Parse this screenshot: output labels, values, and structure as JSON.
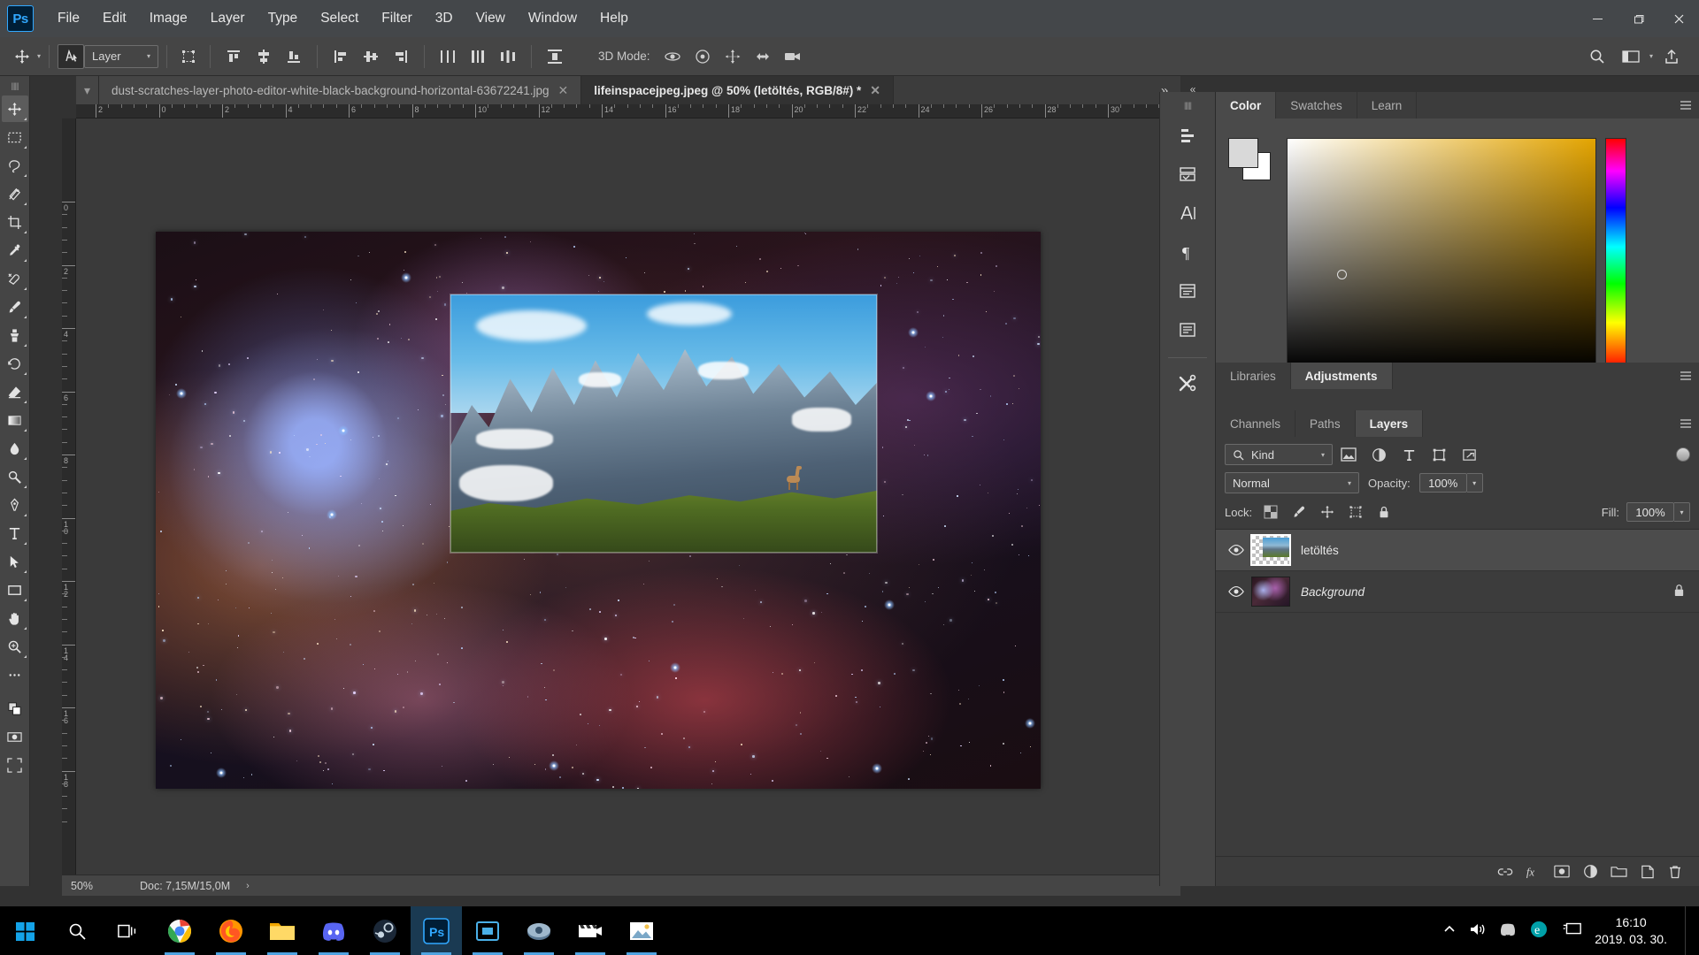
{
  "app": {
    "logo": "Ps",
    "menu": [
      "File",
      "Edit",
      "Image",
      "Layer",
      "Type",
      "Select",
      "Filter",
      "3D",
      "View",
      "Window",
      "Help"
    ],
    "window_controls": {
      "minimize": "—",
      "maximize": "❐",
      "close": "✕"
    }
  },
  "options_bar": {
    "tool_preset_label": "move-tool",
    "layer_select_value": "Layer",
    "mode_3d_label": "3D Mode:",
    "search_icon": "search-icon",
    "arrange_icon": "arrange-documents-icon",
    "share_icon": "share-icon"
  },
  "tabs": [
    {
      "title": "dust-scratches-layer-photo-editor-white-black-background-horizontal-63672241.jpg",
      "active": false,
      "close": "✕"
    },
    {
      "title": "lifeinspacejpeg.jpeg @ 50% (letöltés, RGB/8#) *",
      "active": true,
      "close": "✕"
    }
  ],
  "tab_overflow": "»",
  "toolbar": {
    "tools": [
      {
        "name": "move-tool",
        "glyph": "move"
      },
      {
        "name": "rectangular-marquee-tool",
        "glyph": "marquee"
      },
      {
        "name": "lasso-tool",
        "glyph": "lasso"
      },
      {
        "name": "object-selection-tool",
        "glyph": "wand"
      },
      {
        "name": "crop-tool",
        "glyph": "crop"
      },
      {
        "name": "eyedropper-tool",
        "glyph": "eyedropper"
      },
      {
        "name": "spot-healing-brush-tool",
        "glyph": "healing"
      },
      {
        "name": "brush-tool",
        "glyph": "brush"
      },
      {
        "name": "clone-stamp-tool",
        "glyph": "stamp"
      },
      {
        "name": "history-brush-tool",
        "glyph": "history"
      },
      {
        "name": "eraser-tool",
        "glyph": "eraser"
      },
      {
        "name": "gradient-tool",
        "glyph": "gradient"
      },
      {
        "name": "blur-tool",
        "glyph": "blur"
      },
      {
        "name": "dodge-tool",
        "glyph": "dodge"
      },
      {
        "name": "pen-tool",
        "glyph": "pen"
      },
      {
        "name": "horizontal-type-tool",
        "glyph": "type"
      },
      {
        "name": "path-selection-tool",
        "glyph": "path"
      },
      {
        "name": "rectangle-tool",
        "glyph": "rectangle"
      },
      {
        "name": "hand-tool",
        "glyph": "hand"
      },
      {
        "name": "zoom-tool",
        "glyph": "zoom"
      },
      {
        "name": "edit-toolbar-tool",
        "glyph": "dots"
      }
    ]
  },
  "rulers": {
    "top_labels": [
      "2",
      "0",
      "2",
      "4",
      "6",
      "8",
      "10",
      "12",
      "14",
      "16",
      "18",
      "20",
      "22",
      "24",
      "26",
      "28",
      "30"
    ],
    "left_labels": [
      "0",
      "2",
      "4",
      "6",
      "8",
      "10",
      "12",
      "14",
      "16",
      "18"
    ],
    "unit": "cm"
  },
  "canvas": {
    "document_title": "lifeinspacejpeg.jpeg",
    "zoom": "50%",
    "background_layer_desc": "space nebula photograph",
    "top_layer_desc": "snowy mountain range with guanaco on grass slope"
  },
  "status_bar": {
    "zoom": "50%",
    "doc_label": "Doc: 7,15M/15,0M",
    "expand_arrow": "›"
  },
  "right_rail": {
    "collapse": "«",
    "buttons": [
      {
        "name": "history-panel-icon",
        "glyph": "history"
      },
      {
        "name": "library-panel-icon",
        "glyph": "books"
      },
      {
        "name": "character-panel-icon",
        "glyph": "A"
      },
      {
        "name": "paragraph-panel-icon",
        "glyph": "¶"
      },
      {
        "name": "properties-panel-icon",
        "glyph": "props"
      },
      {
        "name": "notes-panel-icon",
        "glyph": "notes"
      },
      {
        "name": "tools-panel-icon",
        "glyph": "tools"
      }
    ]
  },
  "color_panel": {
    "tabs": [
      {
        "label": "Color",
        "active": true
      },
      {
        "label": "Swatches",
        "active": false
      },
      {
        "label": "Learn",
        "active": false
      }
    ],
    "menu_icon": "panel-menu-icon",
    "foreground_color": "#d9d9d9",
    "background_color": "#ffffff",
    "field_hue_color": "#e3a400"
  },
  "adjustments_group": {
    "tabs": [
      {
        "label": "Libraries",
        "active": false
      },
      {
        "label": "Adjustments",
        "active": true
      }
    ],
    "menu_icon": "panel-menu-icon"
  },
  "layers_panel": {
    "tabs": [
      {
        "label": "Channels",
        "active": false
      },
      {
        "label": "Paths",
        "active": false
      },
      {
        "label": "Layers",
        "active": true
      }
    ],
    "menu_icon": "panel-menu-icon",
    "filter": {
      "kind_label": "Kind",
      "search_icon": "search-icon",
      "caret": "⌄",
      "icons": [
        {
          "name": "filter-pixel-layers-icon"
        },
        {
          "name": "filter-adjustment-layers-icon"
        },
        {
          "name": "filter-type-layers-icon"
        },
        {
          "name": "filter-shape-layers-icon"
        },
        {
          "name": "filter-smart-object-icon"
        }
      ],
      "toggle_name": "filter-enable-toggle"
    },
    "blend_mode": "Normal",
    "opacity_label": "Opacity:",
    "opacity_value": "100%",
    "lock_label": "Lock:",
    "lock_icons": [
      {
        "name": "lock-transparent-pixels-icon"
      },
      {
        "name": "lock-image-pixels-icon"
      },
      {
        "name": "lock-position-icon"
      },
      {
        "name": "lock-artboard-nesting-icon"
      },
      {
        "name": "lock-all-icon"
      }
    ],
    "fill_label": "Fill:",
    "fill_value": "100%",
    "layers": [
      {
        "name": "letöltés",
        "visible": true,
        "selected": true,
        "locked": false,
        "italic": false,
        "thumb": "mountain"
      },
      {
        "name": "Background",
        "visible": true,
        "selected": false,
        "locked": true,
        "italic": true,
        "thumb": "nebula"
      }
    ],
    "footer_buttons": [
      {
        "name": "link-layers-button",
        "glyph": "⚭"
      },
      {
        "name": "layer-style-button",
        "glyph": "fx"
      },
      {
        "name": "layer-mask-button",
        "glyph": "mask"
      },
      {
        "name": "new-fill-adjustment-button",
        "glyph": "halfcircle"
      },
      {
        "name": "new-group-button",
        "glyph": "folder"
      },
      {
        "name": "new-layer-button",
        "glyph": "newlayer"
      },
      {
        "name": "delete-layer-button",
        "glyph": "trash"
      }
    ]
  },
  "taskbar": {
    "start_icon": "windows-start-icon",
    "search_icon": "search-icon",
    "taskview_icon": "task-view-icon",
    "apps": [
      {
        "name": "google-chrome-taskbar-icon",
        "running": true,
        "active": false
      },
      {
        "name": "firefox-taskbar-icon",
        "running": true,
        "active": false
      },
      {
        "name": "file-explorer-taskbar-icon",
        "running": true,
        "active": false
      },
      {
        "name": "discord-taskbar-icon",
        "running": true,
        "active": false
      },
      {
        "name": "steam-taskbar-icon",
        "running": true,
        "active": false
      },
      {
        "name": "photoshop-taskbar-icon",
        "running": true,
        "active": true
      },
      {
        "name": "video-editor-taskbar-icon",
        "running": true,
        "active": false
      },
      {
        "name": "media-app-taskbar-icon",
        "running": true,
        "active": false
      },
      {
        "name": "movie-app-taskbar-icon",
        "running": true,
        "active": false
      },
      {
        "name": "photos-taskbar-icon",
        "running": true,
        "active": false
      }
    ],
    "tray": [
      {
        "name": "show-hidden-icons-chevron",
        "glyph": "⌃"
      },
      {
        "name": "volume-icon",
        "glyph": "vol"
      },
      {
        "name": "discord-tray-icon",
        "glyph": "dsc"
      },
      {
        "name": "edge-tray-icon",
        "glyph": "e"
      },
      {
        "name": "network-display-icon",
        "glyph": "net"
      }
    ],
    "clock_time": "16:10",
    "clock_date": "2019. 03. 30."
  }
}
